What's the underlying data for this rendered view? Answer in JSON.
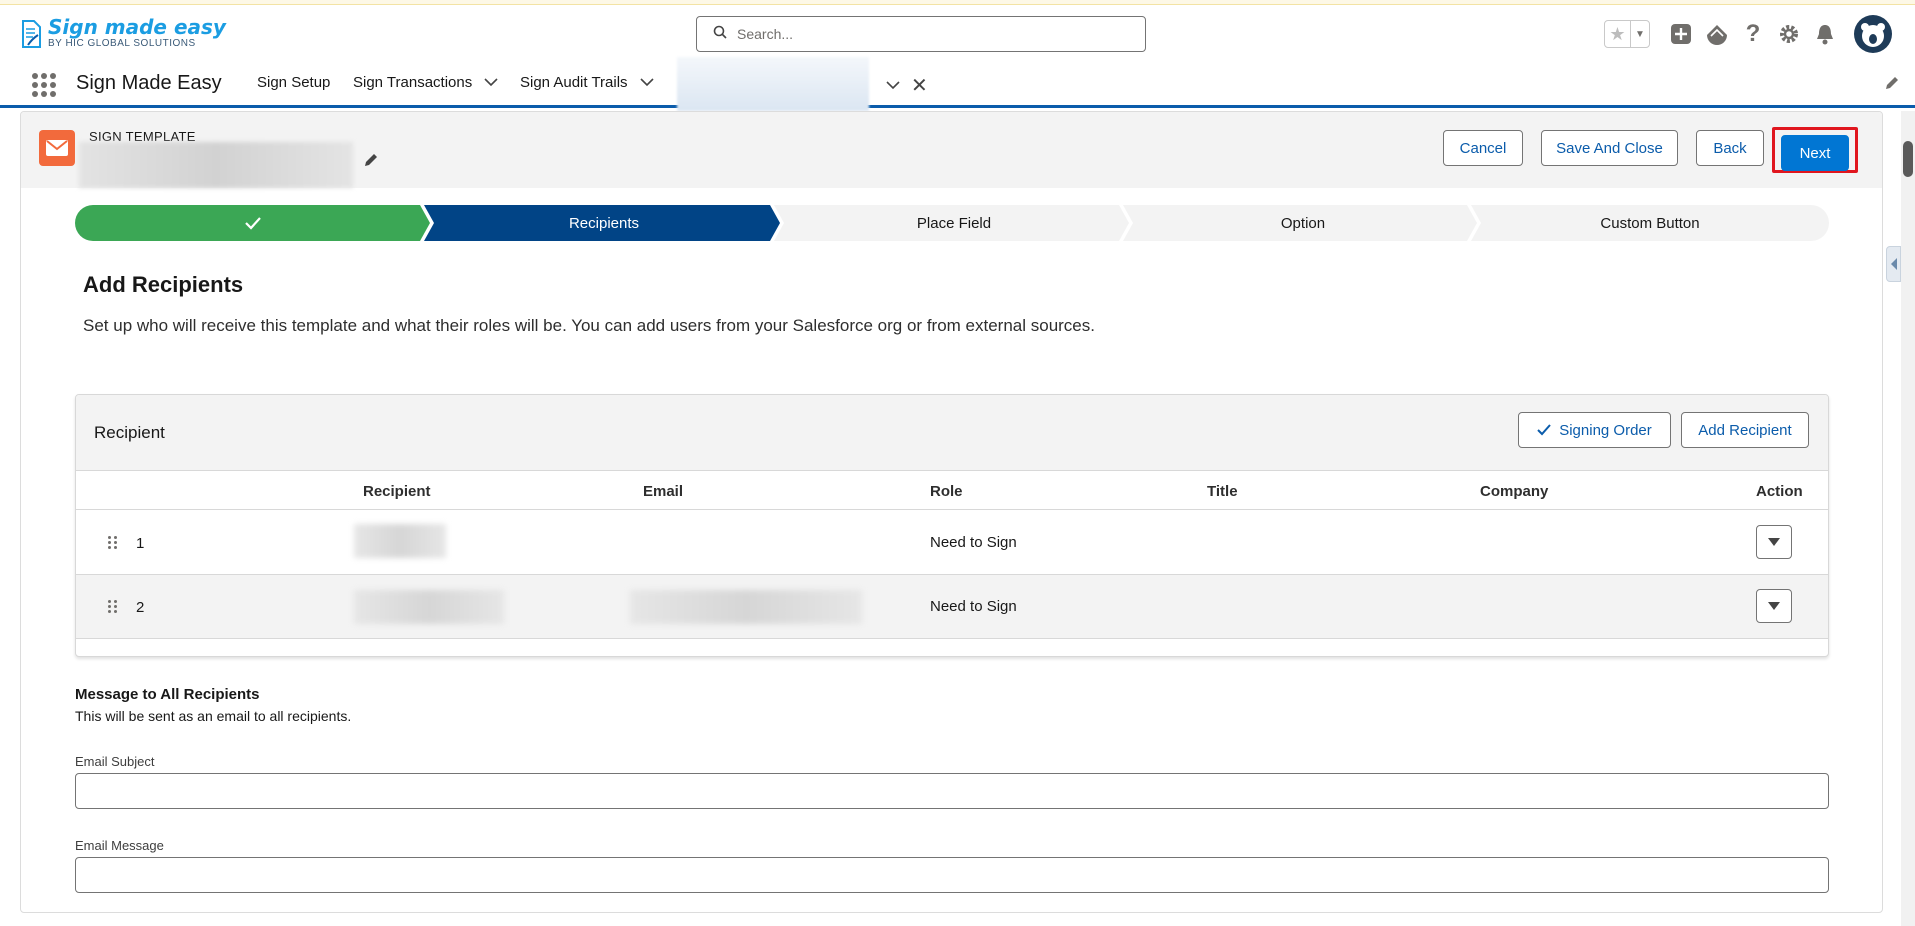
{
  "header": {
    "logo_main": "Sign made easy",
    "logo_sub": "BY HIC GLOBAL SOLUTIONS",
    "search_placeholder": "Search..."
  },
  "nav": {
    "app_name": "Sign Made Easy",
    "items": [
      {
        "label": "Sign Setup"
      },
      {
        "label": "Sign Transactions"
      },
      {
        "label": "Sign Audit Trails"
      }
    ]
  },
  "record": {
    "type_label": "SIGN TEMPLATE",
    "buttons": {
      "cancel": "Cancel",
      "save_close": "Save And Close",
      "back": "Back",
      "next": "Next"
    }
  },
  "path": {
    "stages": [
      {
        "label": "",
        "status": "complete"
      },
      {
        "label": "Recipients",
        "status": "current"
      },
      {
        "label": "Place Field",
        "status": "incomplete"
      },
      {
        "label": "Option",
        "status": "incomplete"
      },
      {
        "label": "Custom Button",
        "status": "incomplete"
      }
    ]
  },
  "section": {
    "title": "Add Recipients",
    "description": "Set up who will receive this template and what their roles will be. You can add users from your Salesforce org or from external sources."
  },
  "recipients": {
    "card_title": "Recipient",
    "signing_order_label": "Signing Order",
    "add_recipient_label": "Add Recipient",
    "columns": [
      "Recipient",
      "Email",
      "Role",
      "Title",
      "Company",
      "Action"
    ],
    "rows": [
      {
        "order": "1",
        "role": "Need to Sign"
      },
      {
        "order": "2",
        "role": "Need to Sign"
      }
    ]
  },
  "message": {
    "title": "Message to All Recipients",
    "description": "This will be sent as an email to all recipients.",
    "subject_label": "Email Subject",
    "subject_value": "",
    "message_label": "Email Message",
    "message_value": ""
  },
  "colors": {
    "brand": "#0176d3",
    "path_complete": "#3ba755",
    "path_current": "#014486",
    "path_incomplete": "#f3f3f3",
    "highlight": "#e0161e",
    "record_icon": "#f26a3c"
  }
}
